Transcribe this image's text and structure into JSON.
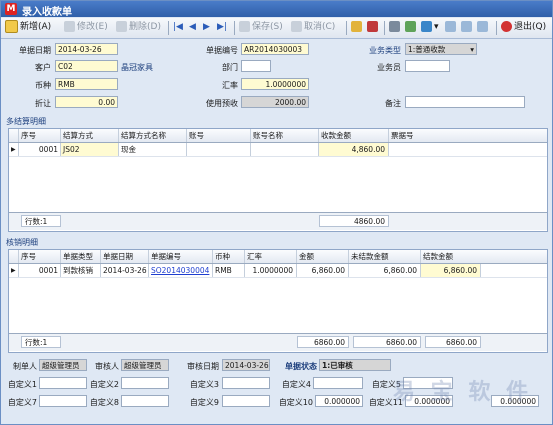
{
  "window": {
    "title": "录入收款单"
  },
  "toolbar": {
    "new": "新增(A)",
    "edit": "修改(E)",
    "delete": "删除(D)",
    "save": "保存(S)",
    "cancel": "取消(C)",
    "exit": "退出(Q)"
  },
  "header": {
    "date_label": "单据日期",
    "date": "2014-03-26",
    "no_label": "单据编号",
    "no": "AR2014030003",
    "biztype_label": "业务类型",
    "biztype": "1:普通收款",
    "customer_label": "客户",
    "customer_code": "C02",
    "customer_name": "晶冠家具",
    "dept_label": "部门",
    "dept": "",
    "staff_label": "业务员",
    "staff": "",
    "currency_label": "币种",
    "currency": "RMB",
    "rate_label": "汇率",
    "rate": "1.0000000",
    "discount_label": "折让",
    "discount": "0.00",
    "prepay_label": "使用预收",
    "prepay": "2000.00",
    "remark_label": "备注",
    "remark": ""
  },
  "settle": {
    "section": "多结算明细",
    "columns": [
      "序号",
      "结算方式",
      "结算方式名称",
      "账号",
      "账号名称",
      "收款金额",
      "票据号"
    ],
    "rows": [
      {
        "seq": "0001",
        "code": "JS02",
        "name": "现金",
        "acct": "",
        "acct_name": "",
        "amount": "4,860.00",
        "bill": ""
      }
    ],
    "footer_label": "行数:1",
    "footer_total": "4860.00"
  },
  "verify": {
    "section": "核销明细",
    "columns": [
      "序号",
      "单据类型",
      "单据日期",
      "单据编号",
      "币种",
      "汇率",
      "金额",
      "未结款金额",
      "结款金额"
    ],
    "rows": [
      {
        "seq": "0001",
        "type": "到款核销",
        "date": "2014-03-26",
        "no": "SO2014030004",
        "cur": "RMB",
        "rate": "1.0000000",
        "amount": "6,860.00",
        "unpaid": "6,860.00",
        "paid": "6,860.00"
      }
    ],
    "footer_label": "行数:1",
    "footer_totals": [
      "6860.00",
      "6860.00",
      "6860.00"
    ]
  },
  "audit": {
    "maker_label": "制单人",
    "maker": "超级管理员",
    "auditor_label": "审核人",
    "auditor": "超级管理员",
    "audit_date_label": "审核日期",
    "audit_date": "2014-03-26",
    "status_label": "单据状态",
    "status": "1:已审核"
  },
  "custom": {
    "c1": "自定义1",
    "c2": "自定义2",
    "c3": "自定义3",
    "c4": "自定义4",
    "c5": "自定义5",
    "c7": "自定义7",
    "c8": "自定义8",
    "c9": "自定义9",
    "c10": "自定义10",
    "c11": "自定义11",
    "v10": "0.000000",
    "v11": "0.000000",
    "v12": "0.000000"
  }
}
